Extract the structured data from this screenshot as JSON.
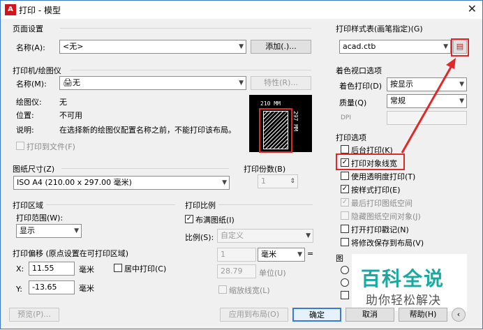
{
  "title": "打印 - 模型",
  "page_setup": {
    "section": "页面设置",
    "name_label": "名称(A):",
    "name_value": "<无>",
    "add_button": "添加(.)..."
  },
  "printer": {
    "section": "打印机/绘图仪",
    "name_label": "名称(M):",
    "name_value": "无",
    "properties_button": "特性(R)...",
    "plotter_label": "绘图仪:",
    "plotter_value": "无",
    "location_label": "位置:",
    "location_value": "不可用",
    "desc_label": "说明:",
    "desc_value": "在选择新的绘图仪配置名称之前，不能打印该布局。",
    "print_to_file": "打印到文件(F)"
  },
  "preview_dims": {
    "width": "210 MM",
    "height": "297 MM"
  },
  "paper": {
    "section": "图纸尺寸(Z)",
    "value": "ISO A4 (210.00 x 297.00 毫米)"
  },
  "copies": {
    "section": "打印份数(B)",
    "value": "1"
  },
  "area": {
    "section": "打印区域",
    "range_label": "打印范围(W):",
    "range_value": "显示"
  },
  "offset": {
    "section": "打印偏移 (原点设置在可打印区域)",
    "x_label": "X:",
    "x_value": "11.55",
    "x_unit": "毫米",
    "y_label": "Y:",
    "y_value": "-13.65",
    "y_unit": "毫米",
    "center": "居中打印(C)"
  },
  "scale": {
    "section": "打印比例",
    "fit": "布满图纸(I)",
    "ratio_label": "比例(S):",
    "ratio_value": "自定义",
    "v1": "1",
    "unit": "毫米",
    "v2": "28.79",
    "unit2": "单位(U)",
    "lw": "缩放线宽(L)"
  },
  "style_table": {
    "section": "打印样式表(画笔指定)(G)",
    "value": "acad.ctb"
  },
  "shaded": {
    "section": "着色视口选项",
    "shade_label": "着色打印(D)",
    "shade_value": "按显示",
    "quality_label": "质量(Q)",
    "quality_value": "常规",
    "dpi_label": "DPI"
  },
  "options": {
    "section": "打印选项",
    "items": [
      "后台打印(K)",
      "打印对象线宽",
      "使用透明度打印(T)",
      "按样式打印(E)",
      "最后打印图纸空间",
      "隐藏图纸空间对象(J)",
      "打开打印戳记(N)",
      "将修改保存到布局(V)"
    ]
  },
  "orient": {
    "section": "图"
  },
  "buttons": {
    "preview": "预览(P)...",
    "apply": "应用到布局(O)",
    "ok": "确定",
    "cancel": "取消",
    "help": "帮助(H)"
  },
  "watermark": {
    "line1": "百科全说",
    "line2": "助你轻松解决"
  },
  "colors": {
    "accent": "#3c78d8",
    "highlight": "#e02828",
    "watermark": "#1aa9a0"
  }
}
